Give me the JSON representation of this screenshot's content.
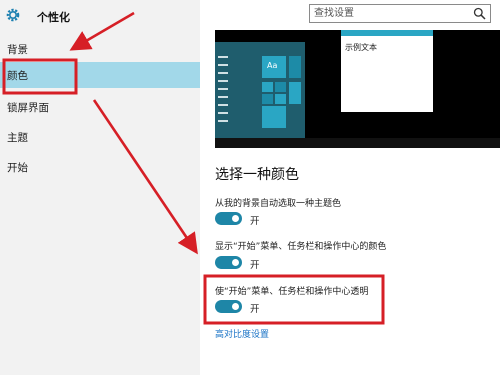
{
  "header": {
    "title": "个性化"
  },
  "search": {
    "placeholder": "查找设置"
  },
  "sidebar": {
    "items": [
      {
        "label": "背景"
      },
      {
        "label": "颜色"
      },
      {
        "label": "锁屏界面"
      },
      {
        "label": "主题"
      },
      {
        "label": "开始"
      }
    ]
  },
  "preview": {
    "tile_label": "Aa",
    "sample_text": "示例文本"
  },
  "main": {
    "heading": "选择一种颜色",
    "options": [
      {
        "label": "从我的背景自动选取一种主题色",
        "state": "开"
      },
      {
        "label": "显示“开始”菜单、任务栏和操作中心的颜色",
        "state": "开"
      },
      {
        "label": "使“开始”菜单、任务栏和操作中心透明",
        "state": "开"
      }
    ],
    "link": "高对比度设置"
  },
  "colors": {
    "accent": "#1e86a7",
    "nav_highlight": "#a2d8e9",
    "annotation": "#d61f26"
  }
}
